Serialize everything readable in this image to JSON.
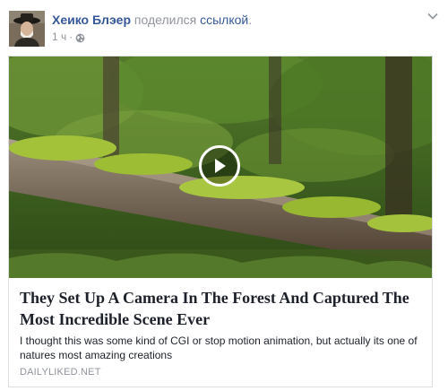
{
  "post": {
    "actor_name": "Хеико Блэер",
    "action_text": " поделился ",
    "action_link": "ссылкой",
    "action_end": ".",
    "timestamp": "1 ч",
    "separator": "·",
    "privacy_icon": "globe-icon",
    "options_icon": "chevron-down-icon"
  },
  "attachment": {
    "media_icon": "play-icon",
    "title": "They Set Up A Camera In The Forest And Captured The Most Incredible Scene Ever",
    "description": "I thought this was some kind of CGI or stop motion animation, but actually its one of natures most amazing creations",
    "domain": "DAILYLIKED.NET"
  }
}
